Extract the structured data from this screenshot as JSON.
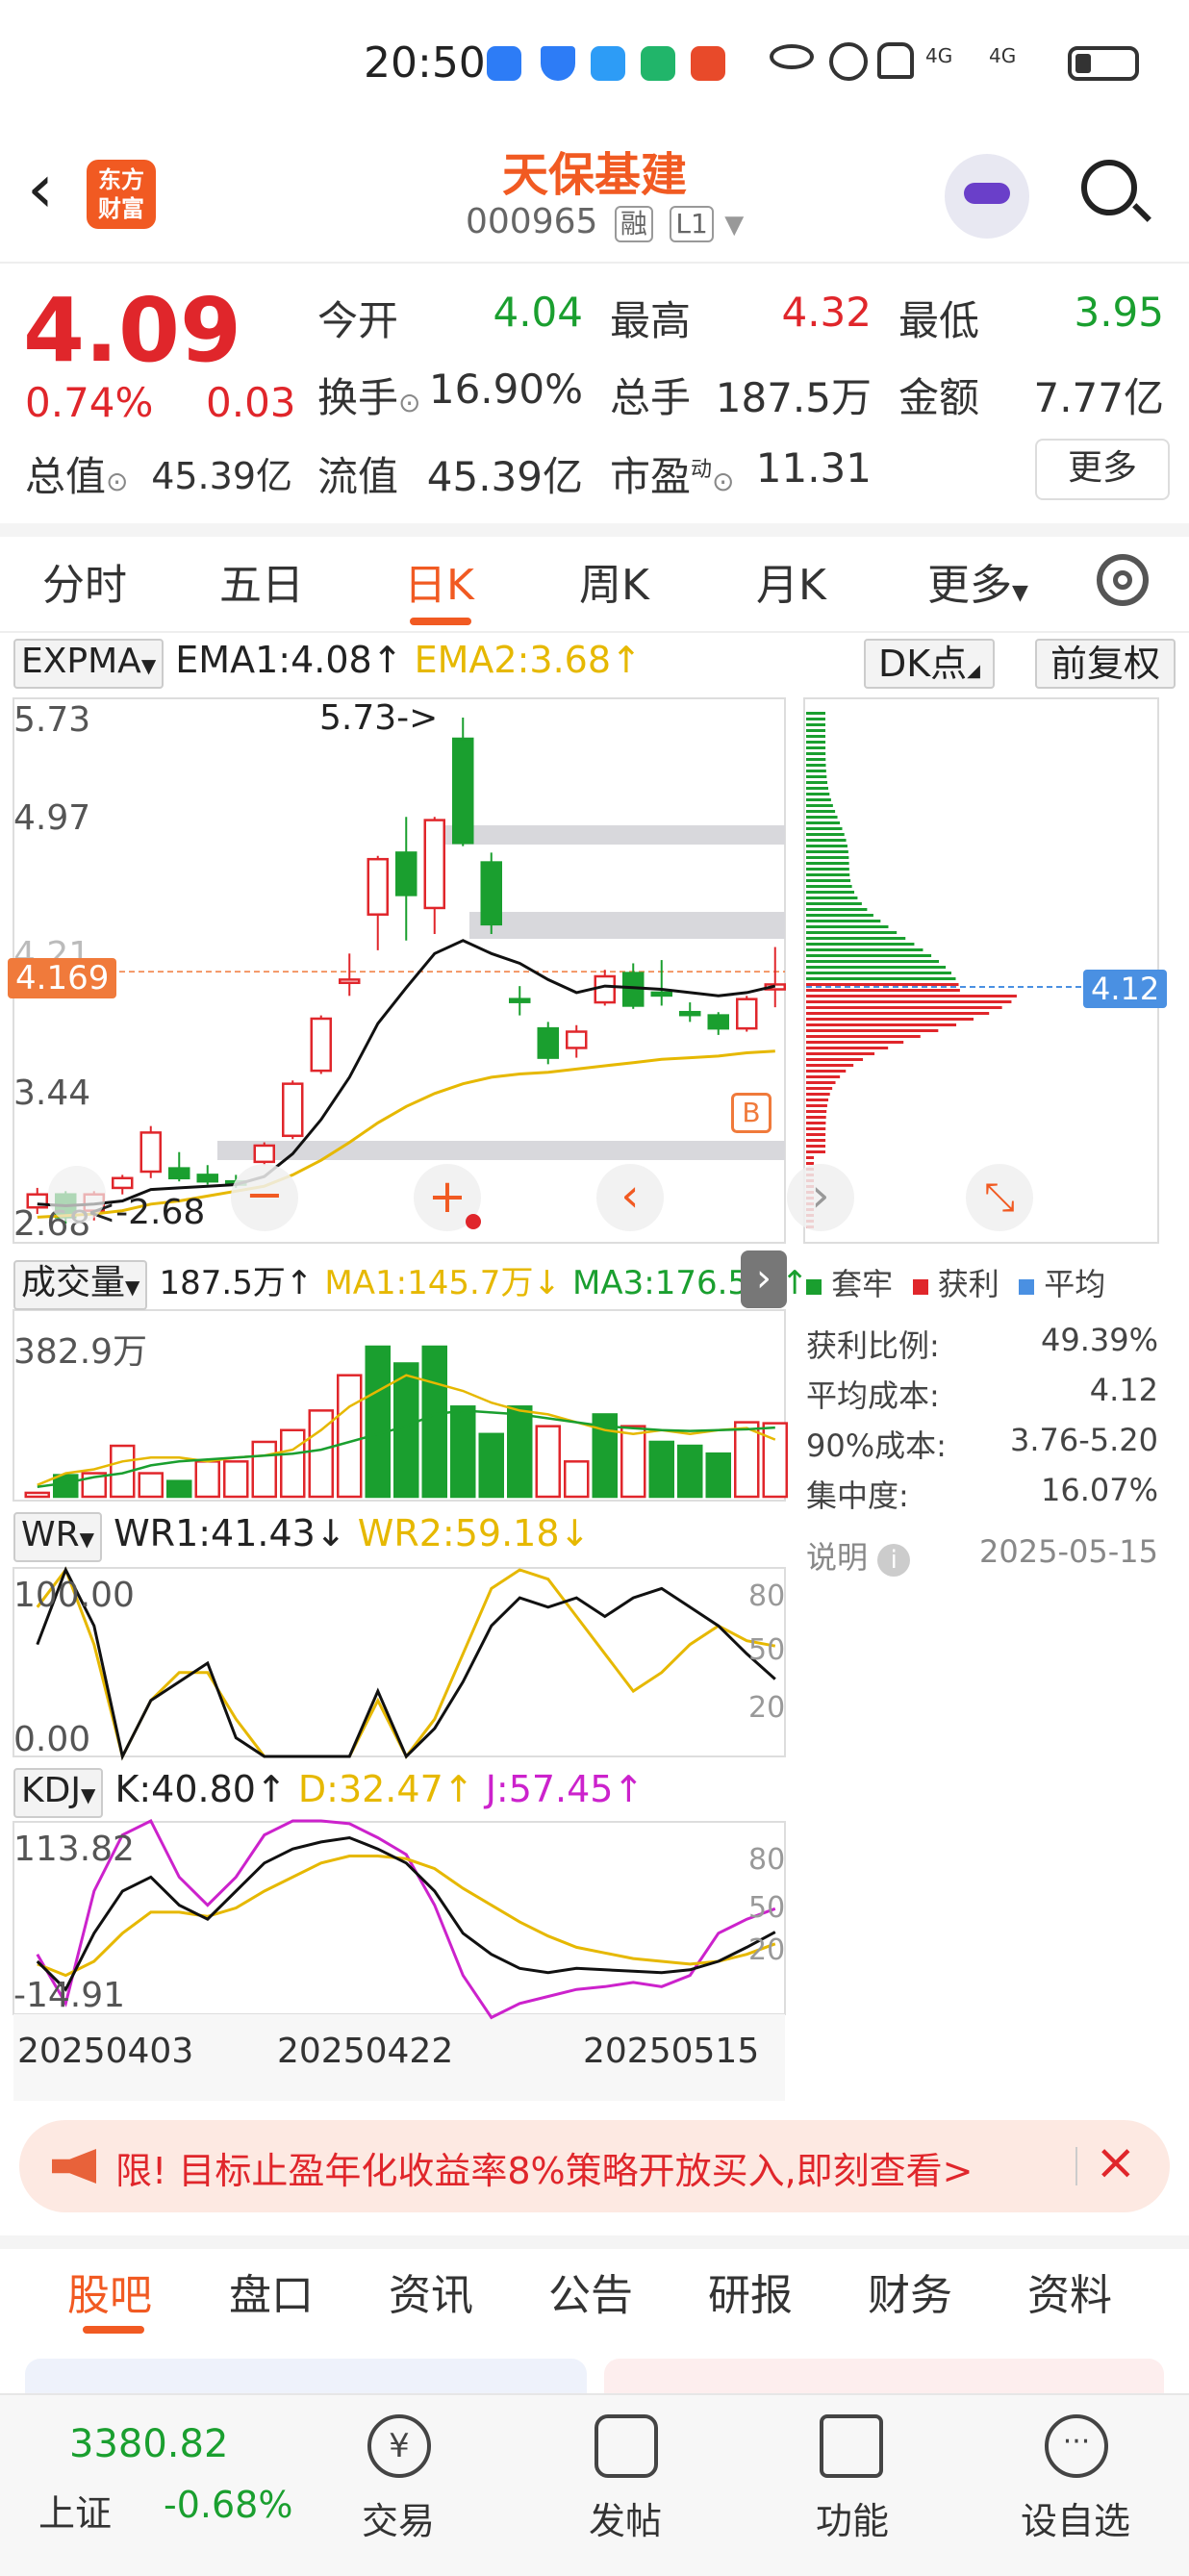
{
  "status_bar": {
    "time": "20:50",
    "network": "4G"
  },
  "header": {
    "logo_text_1": "东方",
    "logo_text_2": "财富",
    "stock_name": "天保基建",
    "stock_code": "000965",
    "tag_margin": "融",
    "tag_level": "L1"
  },
  "quote": {
    "price": "4.09",
    "change_pct": "0.74%",
    "change": "0.03",
    "open_label": "今开",
    "open": "4.04",
    "high_label": "最高",
    "high": "4.32",
    "low_label": "最低",
    "low": "3.95",
    "turnover_label": "换手",
    "turnover": "16.90%",
    "volume_label": "总手",
    "volume": "187.5万",
    "amount_label": "金额",
    "amount": "7.77亿",
    "mktcap_label": "总值",
    "mktcap": "45.39亿",
    "float_label": "流值",
    "float_cap": "45.39亿",
    "pe_label": "市盈",
    "pe_sup": "动",
    "pe": "11.31",
    "more_label": "更多"
  },
  "kline_tabs": [
    "分时",
    "五日",
    "日K",
    "周K",
    "月K",
    "更多"
  ],
  "active_tab": "日K",
  "main_indicator": {
    "name": "EXPMA",
    "ema1": "EMA1:4.08↑",
    "ema2": "EMA2:3.68↑",
    "dk_label": "DK点",
    "adj_label": "前复权"
  },
  "price_axis": {
    "t1": "5.73",
    "t2": "4.97",
    "t3": "4.21",
    "t4": "3.44",
    "t5": "2.68",
    "current": "4.169",
    "high_note": "5.73->",
    "low_note": "<-2.68",
    "b_label": "B"
  },
  "volume_panel": {
    "name": "成交量",
    "vol": "187.5万↑",
    "ma1": "MA1:145.7万↓",
    "ma3": "MA3:176.5万↑",
    "max": "382.9万"
  },
  "wr_panel": {
    "name": "WR",
    "wr1": "WR1:41.43↓",
    "wr2": "WR2:59.18↓",
    "top": "100.00",
    "bottom": "0.00",
    "l80": "80",
    "l50": "50",
    "l20": "20"
  },
  "kdj_panel": {
    "name": "KDJ",
    "k": "K:40.80↑",
    "d": "D:32.47↑",
    "j": "J:57.45↑",
    "top": "113.82",
    "bottom": "-14.91",
    "l80": "80",
    "l50": "50",
    "l20": "20"
  },
  "dates": [
    "20250403",
    "20250422",
    "20250515"
  ],
  "chip": {
    "current_price": "4.12",
    "legend": [
      "套牢",
      "获利",
      "平均"
    ],
    "rows": [
      {
        "label": "获利比例:",
        "value": "49.39%"
      },
      {
        "label": "平均成本:",
        "value": "4.12"
      },
      {
        "label": "90%成本:",
        "value": "3.76-5.20"
      },
      {
        "label": "集中度:",
        "value": "16.07%"
      }
    ],
    "note_label": "说明",
    "date": "2025-05-15"
  },
  "chart_data": {
    "type": "candlestick",
    "dates_shown": [
      "20250403",
      "20250422",
      "20250515"
    ],
    "ylim": [
      2.68,
      5.73
    ],
    "candles": [
      {
        "o": 2.72,
        "c": 2.8,
        "h": 2.84,
        "l": 2.68,
        "color": "red"
      },
      {
        "o": 2.8,
        "c": 2.66,
        "h": 2.82,
        "l": 2.62,
        "color": "green"
      },
      {
        "o": 2.7,
        "c": 2.8,
        "h": 2.82,
        "l": 2.64,
        "color": "red"
      },
      {
        "o": 2.84,
        "c": 2.9,
        "h": 2.92,
        "l": 2.8,
        "color": "red"
      },
      {
        "o": 2.94,
        "c": 3.18,
        "h": 3.22,
        "l": 2.9,
        "color": "red"
      },
      {
        "o": 2.96,
        "c": 2.9,
        "h": 3.06,
        "l": 2.88,
        "color": "green"
      },
      {
        "o": 2.92,
        "c": 2.88,
        "h": 2.98,
        "l": 2.86,
        "color": "green"
      },
      {
        "o": 2.88,
        "c": 2.86,
        "h": 2.92,
        "l": 2.84,
        "color": "green"
      },
      {
        "o": 3.0,
        "c": 3.1,
        "h": 3.12,
        "l": 2.98,
        "color": "red"
      },
      {
        "o": 3.16,
        "c": 3.48,
        "h": 3.5,
        "l": 3.14,
        "color": "red"
      },
      {
        "o": 3.56,
        "c": 3.88,
        "h": 3.9,
        "l": 3.54,
        "color": "red"
      },
      {
        "o": 4.1,
        "c": 4.12,
        "h": 4.28,
        "l": 4.02,
        "color": "red"
      },
      {
        "o": 4.52,
        "c": 4.86,
        "h": 4.88,
        "l": 4.3,
        "color": "red"
      },
      {
        "o": 4.9,
        "c": 4.64,
        "h": 5.12,
        "l": 4.36,
        "color": "green"
      },
      {
        "o": 4.56,
        "c": 5.1,
        "h": 5.12,
        "l": 4.4,
        "color": "red"
      },
      {
        "o": 5.6,
        "c": 4.96,
        "h": 5.73,
        "l": 4.94,
        "color": "green"
      },
      {
        "o": 4.84,
        "c": 4.46,
        "h": 4.9,
        "l": 4.4,
        "color": "green"
      },
      {
        "o": 4.0,
        "c": 4.0,
        "h": 4.08,
        "l": 3.9,
        "color": "green"
      },
      {
        "o": 3.82,
        "c": 3.64,
        "h": 3.86,
        "l": 3.6,
        "color": "green"
      },
      {
        "o": 3.7,
        "c": 3.8,
        "h": 3.84,
        "l": 3.64,
        "color": "red"
      },
      {
        "o": 3.98,
        "c": 4.14,
        "h": 4.18,
        "l": 3.96,
        "color": "red"
      },
      {
        "o": 4.16,
        "c": 3.96,
        "h": 4.22,
        "l": 3.94,
        "color": "green"
      },
      {
        "o": 4.04,
        "c": 4.04,
        "h": 4.24,
        "l": 3.96,
        "color": "green"
      },
      {
        "o": 3.92,
        "c": 3.92,
        "h": 3.98,
        "l": 3.86,
        "color": "green"
      },
      {
        "o": 3.9,
        "c": 3.82,
        "h": 3.92,
        "l": 3.78,
        "color": "green"
      },
      {
        "o": 3.82,
        "c": 4.0,
        "h": 4.02,
        "l": 3.8,
        "color": "red"
      },
      {
        "o": 4.06,
        "c": 4.09,
        "h": 4.32,
        "l": 3.95,
        "color": "red"
      }
    ],
    "ema1": [
      2.74,
      2.73,
      2.74,
      2.76,
      2.83,
      2.84,
      2.85,
      2.86,
      2.91,
      3.05,
      3.26,
      3.52,
      3.85,
      4.07,
      4.28,
      4.36,
      4.28,
      4.22,
      4.12,
      4.04,
      4.08,
      4.07,
      4.06,
      4.04,
      4.02,
      4.04,
      4.08
    ],
    "ema2": [
      2.66,
      2.67,
      2.68,
      2.7,
      2.74,
      2.76,
      2.79,
      2.82,
      2.85,
      2.92,
      3.01,
      3.12,
      3.24,
      3.34,
      3.42,
      3.48,
      3.52,
      3.54,
      3.55,
      3.57,
      3.59,
      3.61,
      3.63,
      3.64,
      3.65,
      3.67,
      3.68
    ],
    "volume_max": 382.9,
    "volume": [
      10,
      55,
      60,
      130,
      60,
      40,
      90,
      90,
      140,
      170,
      220,
      310,
      382.9,
      340,
      382.9,
      230,
      160,
      230,
      180,
      90,
      210,
      180,
      140,
      130,
      110,
      190,
      187.5
    ],
    "volume_colors": [
      "red",
      "green",
      "red",
      "red",
      "red",
      "green",
      "red",
      "red",
      "red",
      "red",
      "red",
      "red",
      "green",
      "green",
      "green",
      "green",
      "green",
      "green",
      "red",
      "red",
      "green",
      "red",
      "green",
      "green",
      "green",
      "red",
      "red"
    ],
    "vol_ma1": [
      30,
      60,
      70,
      90,
      100,
      100,
      90,
      100,
      105,
      120,
      170,
      230,
      270,
      310,
      290,
      270,
      240,
      220,
      210,
      190,
      170,
      160,
      170,
      160,
      170,
      175,
      145.7
    ],
    "vol_ma3": [
      25,
      35,
      50,
      60,
      80,
      90,
      95,
      100,
      105,
      110,
      120,
      140,
      160,
      180,
      210,
      220,
      215,
      210,
      200,
      190,
      180,
      175,
      170,
      168,
      170,
      172,
      176.5
    ],
    "wr1": [
      60,
      100,
      70,
      0,
      30,
      40,
      50,
      10,
      0,
      0,
      0,
      0,
      35,
      0,
      15,
      40,
      70,
      85,
      80,
      85,
      75,
      85,
      90,
      80,
      70,
      55,
      41.43
    ],
    "wr2": [
      80,
      100,
      60,
      0,
      30,
      45,
      45,
      20,
      0,
      0,
      0,
      0,
      30,
      0,
      20,
      55,
      90,
      100,
      95,
      75,
      55,
      35,
      45,
      60,
      70,
      62,
      59.18
    ],
    "kdj_k": [
      20,
      0,
      40,
      70,
      80,
      60,
      50,
      70,
      90,
      100,
      105,
      108,
      100,
      90,
      70,
      40,
      25,
      15,
      12,
      15,
      14,
      13,
      12,
      14,
      20,
      30,
      40.8
    ],
    "kdj_d": [
      18,
      10,
      20,
      40,
      55,
      55,
      52,
      58,
      70,
      80,
      90,
      95,
      95,
      93,
      86,
      72,
      60,
      48,
      38,
      30,
      26,
      22,
      20,
      18,
      20,
      25,
      32.47
    ],
    "kdj_j": [
      25,
      -10,
      70,
      110,
      120,
      80,
      60,
      80,
      110,
      120,
      120,
      118,
      108,
      96,
      60,
      10,
      -20,
      -10,
      -5,
      0,
      2,
      5,
      2,
      10,
      40,
      50,
      57.45
    ]
  },
  "promo": {
    "text": "限!  目标止盈年化收益率8%策略开放买入,即刻查看>"
  },
  "bottom_tabs": [
    "股吧",
    "盘口",
    "资讯",
    "公告",
    "研报",
    "财务",
    "资料"
  ],
  "bottom_tab_active": "股吧",
  "nav": {
    "index_value": "3380.82",
    "index_name": "上证",
    "index_change": "-0.68%",
    "items": [
      "交易",
      "发帖",
      "功能",
      "设自选"
    ]
  },
  "colors": {
    "accent": "#f15a22",
    "up": "#e0262b",
    "down": "#1a9f2f",
    "ema2": "#e6b800",
    "j_line": "#cc22cc"
  }
}
